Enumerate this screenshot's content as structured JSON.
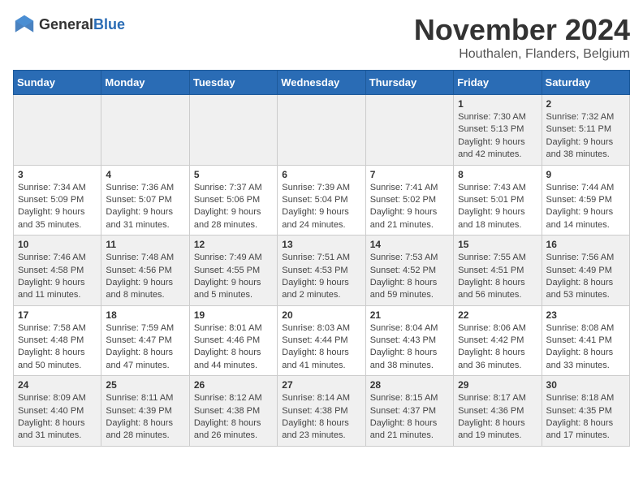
{
  "logo": {
    "text_general": "General",
    "text_blue": "Blue"
  },
  "title": "November 2024",
  "subtitle": "Houthalen, Flanders, Belgium",
  "days_of_week": [
    "Sunday",
    "Monday",
    "Tuesday",
    "Wednesday",
    "Thursday",
    "Friday",
    "Saturday"
  ],
  "weeks": [
    [
      {
        "day": "",
        "info": ""
      },
      {
        "day": "",
        "info": ""
      },
      {
        "day": "",
        "info": ""
      },
      {
        "day": "",
        "info": ""
      },
      {
        "day": "",
        "info": ""
      },
      {
        "day": "1",
        "info": "Sunrise: 7:30 AM\nSunset: 5:13 PM\nDaylight: 9 hours and 42 minutes."
      },
      {
        "day": "2",
        "info": "Sunrise: 7:32 AM\nSunset: 5:11 PM\nDaylight: 9 hours and 38 minutes."
      }
    ],
    [
      {
        "day": "3",
        "info": "Sunrise: 7:34 AM\nSunset: 5:09 PM\nDaylight: 9 hours and 35 minutes."
      },
      {
        "day": "4",
        "info": "Sunrise: 7:36 AM\nSunset: 5:07 PM\nDaylight: 9 hours and 31 minutes."
      },
      {
        "day": "5",
        "info": "Sunrise: 7:37 AM\nSunset: 5:06 PM\nDaylight: 9 hours and 28 minutes."
      },
      {
        "day": "6",
        "info": "Sunrise: 7:39 AM\nSunset: 5:04 PM\nDaylight: 9 hours and 24 minutes."
      },
      {
        "day": "7",
        "info": "Sunrise: 7:41 AM\nSunset: 5:02 PM\nDaylight: 9 hours and 21 minutes."
      },
      {
        "day": "8",
        "info": "Sunrise: 7:43 AM\nSunset: 5:01 PM\nDaylight: 9 hours and 18 minutes."
      },
      {
        "day": "9",
        "info": "Sunrise: 7:44 AM\nSunset: 4:59 PM\nDaylight: 9 hours and 14 minutes."
      }
    ],
    [
      {
        "day": "10",
        "info": "Sunrise: 7:46 AM\nSunset: 4:58 PM\nDaylight: 9 hours and 11 minutes."
      },
      {
        "day": "11",
        "info": "Sunrise: 7:48 AM\nSunset: 4:56 PM\nDaylight: 9 hours and 8 minutes."
      },
      {
        "day": "12",
        "info": "Sunrise: 7:49 AM\nSunset: 4:55 PM\nDaylight: 9 hours and 5 minutes."
      },
      {
        "day": "13",
        "info": "Sunrise: 7:51 AM\nSunset: 4:53 PM\nDaylight: 9 hours and 2 minutes."
      },
      {
        "day": "14",
        "info": "Sunrise: 7:53 AM\nSunset: 4:52 PM\nDaylight: 8 hours and 59 minutes."
      },
      {
        "day": "15",
        "info": "Sunrise: 7:55 AM\nSunset: 4:51 PM\nDaylight: 8 hours and 56 minutes."
      },
      {
        "day": "16",
        "info": "Sunrise: 7:56 AM\nSunset: 4:49 PM\nDaylight: 8 hours and 53 minutes."
      }
    ],
    [
      {
        "day": "17",
        "info": "Sunrise: 7:58 AM\nSunset: 4:48 PM\nDaylight: 8 hours and 50 minutes."
      },
      {
        "day": "18",
        "info": "Sunrise: 7:59 AM\nSunset: 4:47 PM\nDaylight: 8 hours and 47 minutes."
      },
      {
        "day": "19",
        "info": "Sunrise: 8:01 AM\nSunset: 4:46 PM\nDaylight: 8 hours and 44 minutes."
      },
      {
        "day": "20",
        "info": "Sunrise: 8:03 AM\nSunset: 4:44 PM\nDaylight: 8 hours and 41 minutes."
      },
      {
        "day": "21",
        "info": "Sunrise: 8:04 AM\nSunset: 4:43 PM\nDaylight: 8 hours and 38 minutes."
      },
      {
        "day": "22",
        "info": "Sunrise: 8:06 AM\nSunset: 4:42 PM\nDaylight: 8 hours and 36 minutes."
      },
      {
        "day": "23",
        "info": "Sunrise: 8:08 AM\nSunset: 4:41 PM\nDaylight: 8 hours and 33 minutes."
      }
    ],
    [
      {
        "day": "24",
        "info": "Sunrise: 8:09 AM\nSunset: 4:40 PM\nDaylight: 8 hours and 31 minutes."
      },
      {
        "day": "25",
        "info": "Sunrise: 8:11 AM\nSunset: 4:39 PM\nDaylight: 8 hours and 28 minutes."
      },
      {
        "day": "26",
        "info": "Sunrise: 8:12 AM\nSunset: 4:38 PM\nDaylight: 8 hours and 26 minutes."
      },
      {
        "day": "27",
        "info": "Sunrise: 8:14 AM\nSunset: 4:38 PM\nDaylight: 8 hours and 23 minutes."
      },
      {
        "day": "28",
        "info": "Sunrise: 8:15 AM\nSunset: 4:37 PM\nDaylight: 8 hours and 21 minutes."
      },
      {
        "day": "29",
        "info": "Sunrise: 8:17 AM\nSunset: 4:36 PM\nDaylight: 8 hours and 19 minutes."
      },
      {
        "day": "30",
        "info": "Sunrise: 8:18 AM\nSunset: 4:35 PM\nDaylight: 8 hours and 17 minutes."
      }
    ]
  ]
}
